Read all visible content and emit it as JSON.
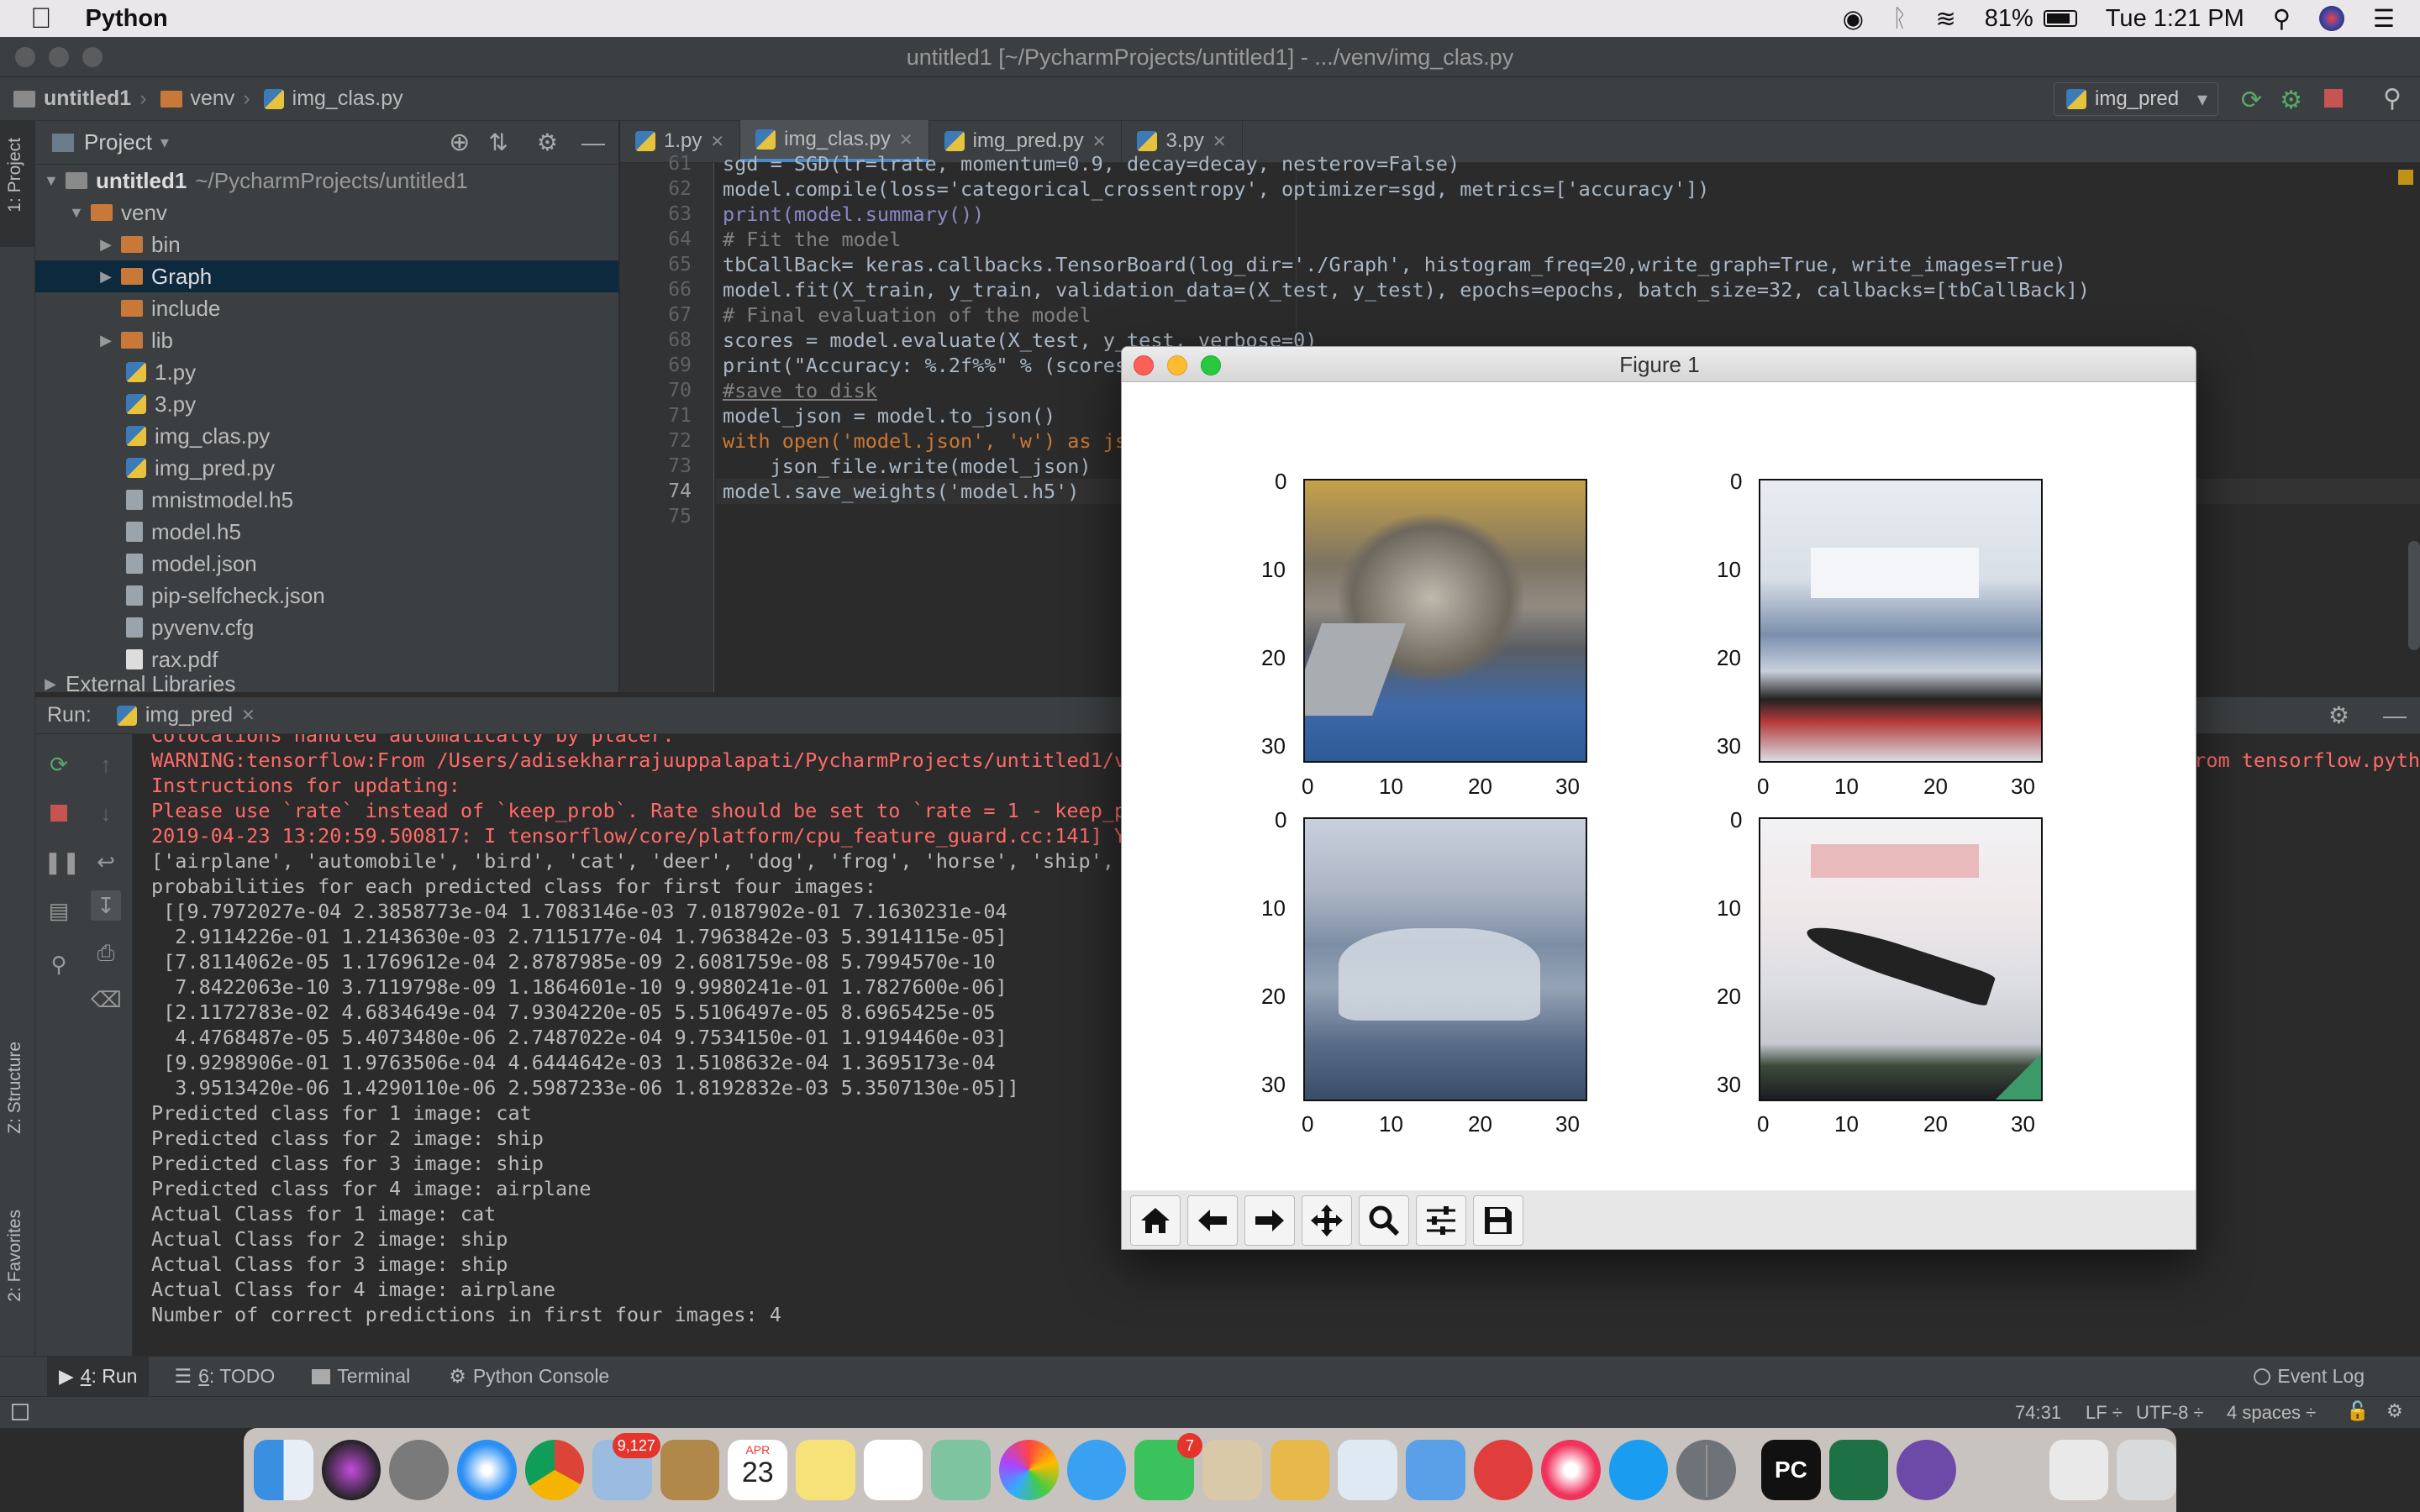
{
  "menubar": {
    "app_name": "Python",
    "battery": "81%",
    "clock": "Tue 1:21 PM"
  },
  "window": {
    "title": "untitled1 [~/PycharmProjects/untitled1] - .../venv/img_clas.py"
  },
  "nav": {
    "crumbs": [
      "untitled1",
      "venv",
      "img_clas.py"
    ],
    "run_config": "img_pred"
  },
  "project": {
    "header": "Project",
    "root_name": "untitled1",
    "root_path": "~/PycharmProjects/untitled1",
    "items": [
      "venv",
      "bin",
      "Graph",
      "include",
      "lib",
      "1.py",
      "3.py",
      "img_clas.py",
      "img_pred.py",
      "mnistmodel.h5",
      "model.h5",
      "model.json",
      "pip-selfcheck.json",
      "pyvenv.cfg",
      "rax.pdf",
      "External Libraries"
    ]
  },
  "stripe": {
    "project": "1: Project",
    "structure": "Z: Structure",
    "favorites": "2: Favorites"
  },
  "editor": {
    "tabs": [
      "1.py",
      "img_clas.py",
      "img_pred.py",
      "3.py"
    ],
    "line_numbers": [
      "61",
      "62",
      "63",
      "64",
      "65",
      "66",
      "67",
      "68",
      "69",
      "70",
      "71",
      "72",
      "73",
      "74",
      "75"
    ],
    "lines": [
      "sgd = SGD(lr=lrate, momentum=0.9, decay=decay, nesterov=False)",
      "model.compile(loss='categorical_crossentropy', optimizer=sgd, metrics=['accuracy'])",
      "print(model.summary())",
      "# Fit the model",
      "tbCallBack= keras.callbacks.TensorBoard(log_dir='./Graph', histogram_freq=20,write_graph=True, write_images=True)",
      "model.fit(X_train, y_train, validation_data=(X_test, y_test), epochs=epochs, batch_size=32, callbacks=[tbCallBack])",
      "# Final evaluation of the model",
      "scores = model.evaluate(X_test, y_test, verbose=0)",
      "print(\"Accuracy: %.2f%%\" % (scores",
      "#save to disk",
      "model_json = model.to_json()",
      "with open('model.json', 'w') as js",
      "    json_file.write(model_json)",
      "model.save_weights('model.h5')",
      ""
    ]
  },
  "run": {
    "label": "Run:",
    "tab": "img_pred"
  },
  "console": {
    "lines": [
      "Colocations handled automatically by placer.",
      "WARNING:tensorflow:From /Users/adisekharrajuuppalapati/PycharmProjects/untitled1/ve",
      "Instructions for updating:",
      "Please use `rate` instead of `keep_prob`. Rate should be set to `rate = 1 - keep_pr",
      "2019-04-23 13:20:59.500817: I tensorflow/core/platform/cpu_feature_guard.cc:141] Yo",
      "['airplane', 'automobile', 'bird', 'cat', 'deer', 'dog', 'frog', 'horse', 'ship', ",
      "probabilities for each predicted class for first four images:",
      " [[9.7972027e-04 2.3858773e-04 1.7083146e-03 7.0187902e-01 7.1630231e-04",
      "  2.9114226e-01 1.2143630e-03 2.7115177e-04 1.7963842e-03 5.3914115e-05]",
      " [7.8114062e-05 1.1769612e-04 2.8787985e-09 2.6081759e-08 5.7994570e-10",
      "  7.8422063e-10 3.7119798e-09 1.1864601e-10 9.9980241e-01 1.7827600e-06]",
      " [2.1172783e-02 4.6834649e-04 7.9304220e-05 5.5106497e-05 8.6965425e-05",
      "  4.4768487e-05 5.4073480e-06 2.7487022e-04 9.7534150e-01 1.9194460e-03]",
      " [9.9298906e-01 1.9763506e-04 4.6444642e-03 1.5108632e-04 1.3695173e-04",
      "  3.9513420e-06 1.4290110e-06 2.5987233e-06 1.8192832e-03 5.3507130e-05]]",
      "Predicted class for 1 image: cat",
      "Predicted class for 2 image: ship",
      "Predicted class for 3 image: ship",
      "Predicted class for 4 image: airplane",
      "Actual Class for 1 image: cat",
      "Actual Class for 2 image: ship",
      "Actual Class for 3 image: ship",
      "Actual Class for 4 image: airplane",
      "Number of correct predictions in first four images: 4"
    ],
    "overflow_right": "rom tensorflow.pyth"
  },
  "figure": {
    "title": "Figure 1",
    "yticks": [
      "0",
      "10",
      "20",
      "30"
    ],
    "xticks": [
      "0",
      "10",
      "20",
      "30"
    ]
  },
  "bottom_tabs": [
    {
      "num": "4",
      "label": ": Run"
    },
    {
      "num": "6",
      "label": ": TODO"
    },
    {
      "num": "",
      "label": "Terminal"
    },
    {
      "num": "",
      "label": "Python Console"
    }
  ],
  "event_log": "Event Log",
  "status": {
    "position": "74:31",
    "line_sep": "LF ÷",
    "encoding": "UTF-8 ÷",
    "indent": "4 spaces ÷"
  },
  "dock": {
    "mail_badge": "9,127",
    "calendar_month": "APR",
    "calendar_day": "23",
    "facetime_badge": "7",
    "pycharm_label": "PC"
  }
}
